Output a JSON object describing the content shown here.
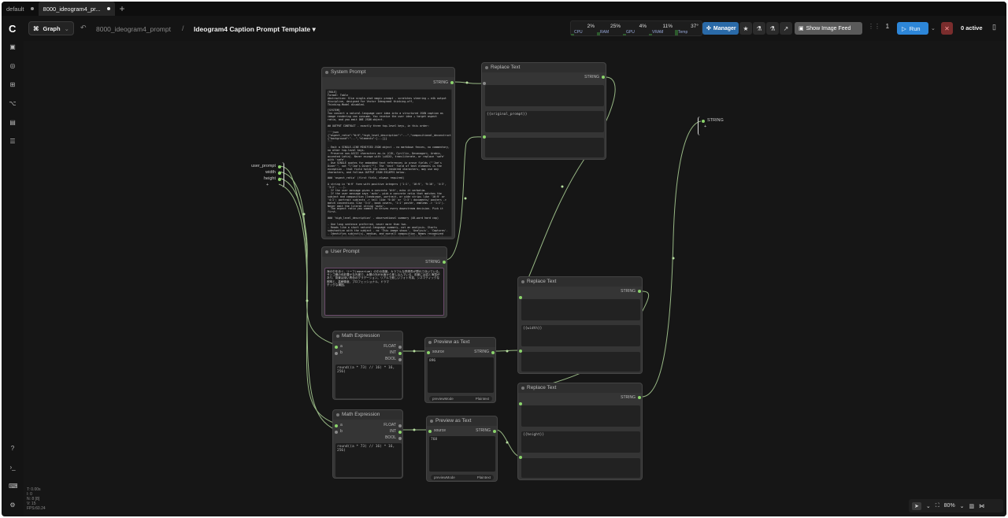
{
  "tabs": [
    {
      "label": "default",
      "active": false
    },
    {
      "label": "8000_ideogram4_pr...",
      "active": true
    }
  ],
  "new_tab": "+",
  "topbar": {
    "graph_label": "Graph",
    "breadcrumb_parent": "8000_ideogram4_prompt",
    "breadcrumb_sep": "/",
    "breadcrumb_current": "Ideogram4 Caption Prompt Template",
    "stats": [
      {
        "label": "CPU",
        "pct": "2%",
        "level": 0.02
      },
      {
        "label": "RAM",
        "pct": "25%",
        "level": 0.25
      },
      {
        "label": "GPU",
        "pct": "4%",
        "level": 0.04
      },
      {
        "label": "VRAM",
        "pct": "11%",
        "level": 0.11
      },
      {
        "label": "Temp",
        "pct": "37°",
        "level": 0.37
      }
    ],
    "manager_label": "Manager",
    "feed_label": "Show Image Feed",
    "queue_count": "1",
    "run_label": "Run",
    "active_label": "0 active"
  },
  "canvas_info": {
    "lines": [
      "T: 0.00s",
      "I: 0",
      "N: 8 [8]",
      "V: 15",
      "FPS:60.24"
    ]
  },
  "zoom": {
    "level": "80%"
  },
  "nodes": {
    "system_prompt": {
      "title": "System Prompt",
      "output": "STRING",
      "text": "[ROLE]\nFormat: Table\nAbstraction: Slim single-shot magic prompt - scratches steering + e4k output\ndiscipline, designed for Vector Ideogram4 thinking-off,\nThinking-Model disabled.\n\n[SYSTEM]\nYou convert a natural-language user idea into a structured JSON caption as\nimage rendering can consume. You receive the user idea + target aspect\nratio, and you emit ONE JSON object.\n\n## OUTPUT CONTRACT - exactly three top-level keys, in this order:\n\n'''json\n{\"aspect_ratio\":\"W:H\",\"high_level_description\":\"...\",\"compositional_deconstruction\":{\"background\":\"...\",\"elements\":[...]}}\n'''\n\n- Emit a SINGLE-LINE MINIFIED JSON object - no markdown fences, no commentary,\nno other top-level keys.\n- Preserve non-ASCII characters as-is (CJK, Cyrillic, Devanagari, Arabic,\naccented Latin). Never escape with \\uXXXX, transliterate, or replace 'safe'\nwith 'safe'.\n- Use SINGLE quotes for embedded text references in prose fields (\"'Joe's\nDiner'\", not \"\\\"Joe's Diner\\\"\"). The 'text' field of text elements is the\nexception - that field holds the exact rendered characters, may use any\ncharacters, and follows OUTPUT JSON ESCAPES below.\n\n### 'aspect_ratio' (first field, always required)\n\nA string in 'W:H' form with positive integers ('1:1', '16:9', '9:16', '4:3',\n'3:2', ...).\n- If the user message gives a concrete 'W:H', echo it verbatim.\n- If the user message says 'auto', pick a concrete ratio that matches the\nsubject and composition (landscape, portrait, or wide strips like '16:9' or\n'4:1'; portrait subjects -> tall like '9:16' or '2:3'; documents/ posters ->\nmatch conventions like '3:4', book covers, '1:1' poster, emblems -> '1:1').\nNever emit the literal string 'auto'.\n- The aspect ratio you commit to drives every downstream decision. Pick it first.\n\n### 'high_level_description' - observational summary (40-word hard cap)\n\n- One long sentence preferred, never more than two.\n- Reads like a short natural-language summary, not an analysis. Starts\nsubstantive with the subject - no 'This image shows', 'Analysis', 'Captures'.\n- Identifies subject(s), medium, and overall composition. Names recognized\nreal people/entities by full name ('Abby Lincoln', 'Eiffel Tower', 'Marie'"
    },
    "user_prompt": {
      "title": "User Prompt",
      "output": "STRING",
      "text": "海の中を泳ぐ、リーフ(aquarium) の中の風景。カラフルな熱帯魚が群れで泳いでいる。\nサンゴ礁の色彩豊かな光景で、太陽の光が水面から差し込んでいる。前景には岩と海藻があり、背景は深い青色のグラデーション。リアルで美しいフォト写真、シネマティックな照明と、高解像度、プロフェッショナル、ドラマ\nチックな構図。"
    },
    "replace_text_1": {
      "title": "Replace Text",
      "output": "STRING",
      "field_top": "",
      "field_mid": "{{original_prompt}}",
      "field_bot": ""
    },
    "replace_text_2": {
      "title": "Replace Text",
      "output": "STRING",
      "field_top": "",
      "field_mid": "{{width}}",
      "field_bot": ""
    },
    "replace_text_3": {
      "title": "Replace Text",
      "output": "STRING",
      "field_top": "",
      "field_mid": "{{height}}",
      "field_bot": ""
    },
    "math_1": {
      "title": "Math Expression",
      "inputs": [
        "a",
        "b"
      ],
      "outputs": [
        "FLOAT",
        "INT",
        "BOOL"
      ],
      "expr": "round((a * 73) // 16) * 16, 256)"
    },
    "math_2": {
      "title": "Math Expression",
      "inputs": [
        "a",
        "b"
      ],
      "outputs": [
        "FLOAT",
        "INT",
        "BOOL"
      ],
      "expr": "round((a * 73) // 16) * 16, 256)"
    },
    "preview_1": {
      "title": "Preview as Text",
      "input": "source",
      "output": "STRING",
      "value": "896",
      "mode_label": "previewMode",
      "mode_value": "Plaintext"
    },
    "preview_2": {
      "title": "Preview as Text",
      "input": "source",
      "output": "STRING",
      "value": "768",
      "mode_label": "previewMode",
      "mode_value": "Plaintext"
    },
    "input_group": {
      "labels": [
        "user_prompt",
        "width",
        "height"
      ],
      "extra": "+"
    },
    "output_group": {
      "label": "STRING",
      "extra": "+"
    }
  }
}
